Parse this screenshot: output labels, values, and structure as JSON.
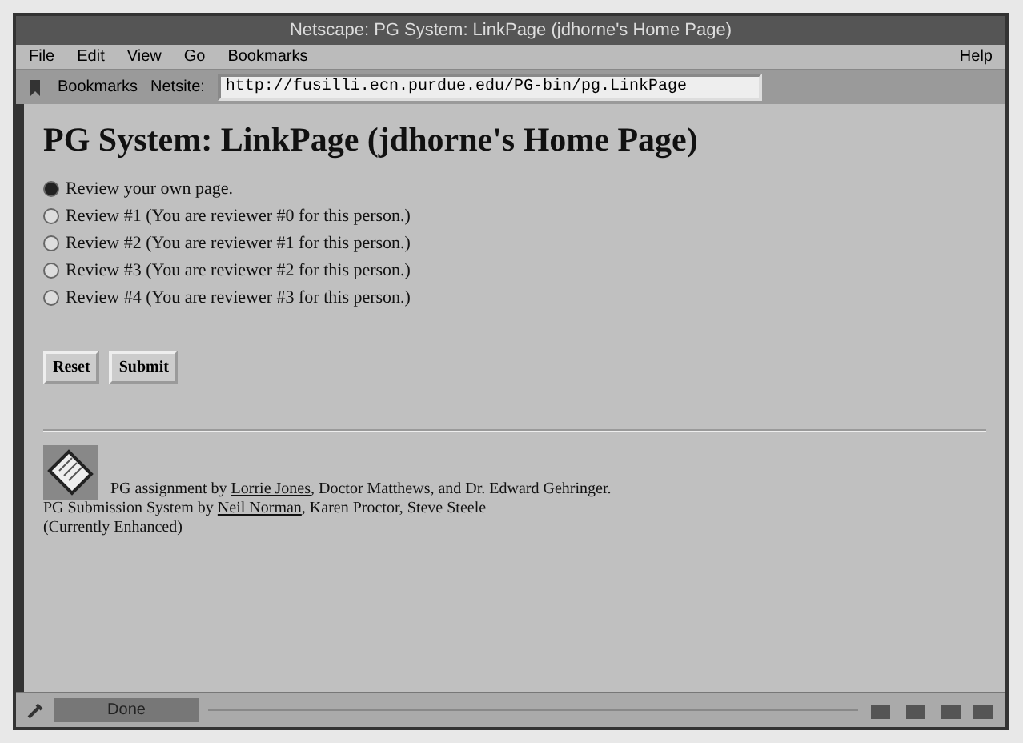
{
  "window": {
    "title": "Netscape: PG System: LinkPage (jdhorne's Home Page)"
  },
  "menu": [
    "File",
    "Edit",
    "View",
    "Go",
    "Bookmarks",
    "Help"
  ],
  "toolbar": {
    "bookmarks_label": "Bookmarks",
    "location_label": "Netsite:",
    "location": "http://fusilli.ecn.purdue.edu/PG-bin/pg.LinkPage"
  },
  "page": {
    "heading": "PG System: LinkPage (jdhorne's Home Page)",
    "options": [
      {
        "label": "Review your own page.",
        "selected": true
      },
      {
        "label": "Review #1 (You are reviewer #0 for this person.)",
        "selected": false
      },
      {
        "label": "Review #2 (You are reviewer #1 for this person.)",
        "selected": false
      },
      {
        "label": "Review #3 (You are reviewer #2 for this person.)",
        "selected": false
      },
      {
        "label": "Review #4 (You are reviewer #3 for this person.)",
        "selected": false
      }
    ],
    "buttons": [
      "Reset",
      "Submit"
    ],
    "credits": [
      {
        "before": "PG assignment by ",
        "link": "Lorrie Jones",
        "after": ", Doctor Matthews, and Dr. Edward Gehringer."
      },
      {
        "before": "PG Submission System by ",
        "link": "Neil Norman",
        "after": ", Karen Proctor, Steve Steele"
      }
    ],
    "note": "(Currently Enhanced)"
  },
  "status_bar": {
    "progress": "Done"
  }
}
